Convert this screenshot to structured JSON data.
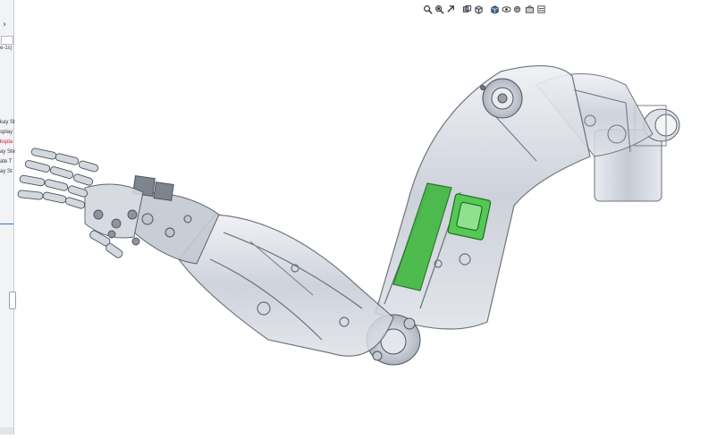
{
  "left_panel": {
    "collapse_glyph": "›",
    "header_text": "e-1s)",
    "property_rows": [
      {
        "label": "kay St",
        "color": "#3a3a3a"
      },
      {
        "label": "splay",
        "color": "#3a3a3a"
      },
      {
        "label": "kspla",
        "color": "#c02020"
      },
      {
        "label": "ay Ste",
        "color": "#3a3a3a"
      },
      {
        "label": "ate T",
        "color": "#3a3a3a"
      },
      {
        "label": "ay St",
        "color": "#3a3a3a"
      }
    ]
  },
  "toolbar": {
    "tools": [
      "zoom-to-fit-icon",
      "zoom-to-area-icon",
      "previous-view-icon",
      "section-view-icon",
      "view-orientation-icon",
      "display-style-icon",
      "hide-show-items-icon",
      "edit-appearance-icon",
      "apply-scene-icon",
      "view-settings-icon"
    ]
  },
  "model": {
    "name": "robotic arm assembly",
    "highlight_color": "#3fb83f",
    "body_color": "#c9cdd6"
  }
}
